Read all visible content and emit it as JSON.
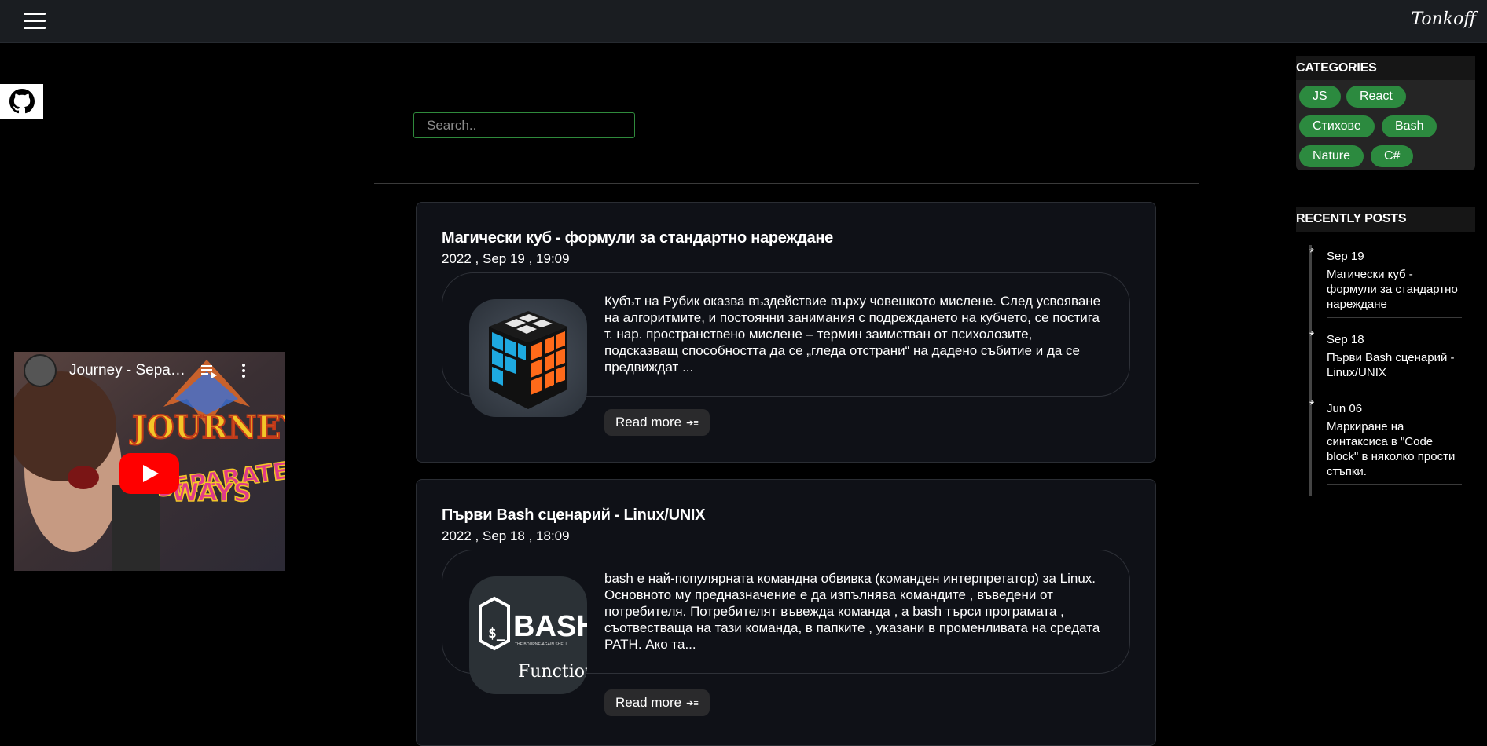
{
  "header": {
    "brand": "Tonkoff",
    "menu_icon": "hamburger-icon"
  },
  "left": {
    "github_icon": "github-icon",
    "video": {
      "title": "Journey - Separate Ways",
      "queue_icon": "playlist-add-icon",
      "more_icon": "more-vert-icon",
      "play_icon": "youtube-play-icon",
      "thumb_text_1": "JOURNEY",
      "thumb_text_2": "SEPARATE",
      "thumb_text_3": "WAYS"
    }
  },
  "search": {
    "placeholder": "Search.."
  },
  "posts": [
    {
      "title": "Магически куб - формули за стандартно нареждане",
      "date": "2022 , Sep 19 , 19:09",
      "excerpt": "Кубът на Рубик оказва въздействие върху човешкото мислене. След усвояване на алгоритмите, и постоянни занимания с подреждането на кубчето, се постига т. нар. пространствено мислене – термин заимстван от психолозите, подсказващ способността да се „гледа отстрани“ на дадено събитие и да се предвиждат ...",
      "read_more": "Read more",
      "image": "rubiks-cube-image"
    },
    {
      "title": "Първи Bash сценарий - Linux/UNIX",
      "date": "2022 , Sep 18 , 18:09",
      "excerpt": "bash е най-популярната командна обвивка (команден интерпретатор) за Linux. Основното му предназначение е да изпълнява командите , въведени от потребителя. Потребителят въвежда команда , а bash търси програмата , съотвестваща на тази команда, в папките , указани в променливата на средата PATH. Ако та...",
      "read_more": "Read more",
      "image": "bash-logo-image",
      "image_text": "BASH",
      "image_subtext": "THE BOURNE-AGAIN SHELL",
      "image_caption": "Functions"
    }
  ],
  "sidebar": {
    "categories_title": "CATEGORIES",
    "categories": [
      "JS",
      "React",
      "Стихове",
      "Bash",
      "Nature",
      "C#"
    ],
    "recent_title": "RECENTLY POSTS",
    "recent": [
      {
        "date": "Sep 19",
        "title": "Магически куб - формули за стандартно нареждане"
      },
      {
        "date": "Sep 18",
        "title": "Първи Bash сценарий - Linux/UNIX"
      },
      {
        "date": "Jun 06",
        "title": "Маркиране на синтаксиса в \"Code block\" в няколко прости стъпки."
      }
    ]
  }
}
